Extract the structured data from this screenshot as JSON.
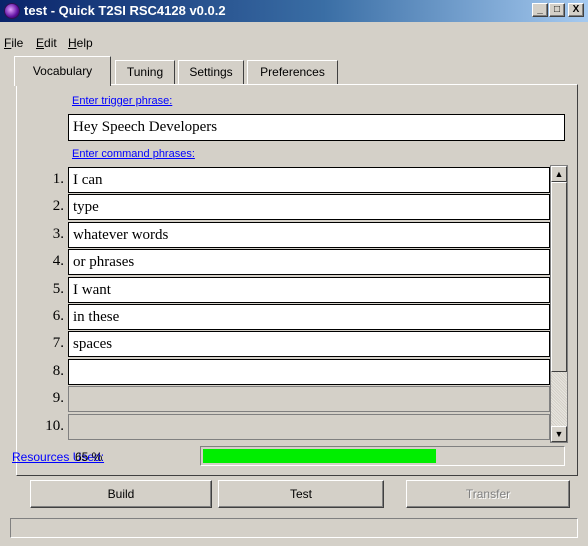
{
  "window": {
    "title": "test - Quick T2SI RSC4128 v0.0.2"
  },
  "titlebar_buttons": {
    "minimize": "_",
    "maximize": "□",
    "close": "X"
  },
  "menu": [
    "File",
    "Edit",
    "Help"
  ],
  "tabs": [
    "Vocabulary",
    "Tuning",
    "Settings",
    "Preferences"
  ],
  "vocabulary": {
    "trigger_label": "Enter trigger phrase:",
    "trigger_value": "Hey Speech Developers",
    "command_label": "Enter command phrases:",
    "commands": [
      {
        "num": "1.",
        "text": "I can"
      },
      {
        "num": "2.",
        "text": "type"
      },
      {
        "num": "3.",
        "text": "whatever words"
      },
      {
        "num": "4.",
        "text": "or phrases"
      },
      {
        "num": "5.",
        "text": "I want"
      },
      {
        "num": "6.",
        "text": "in these"
      },
      {
        "num": "7.",
        "text": "spaces"
      },
      {
        "num": "8.",
        "text": ""
      },
      {
        "num": "9.",
        "text": ""
      },
      {
        "num": "10.",
        "text": ""
      }
    ]
  },
  "resources": {
    "label": "Resources Used:",
    "percent_text": "65 %",
    "percent": 65,
    "bar_color": "#00ee00"
  },
  "buttons": {
    "build": "Build",
    "test": "Test",
    "transfer": "Transfer"
  },
  "status": ""
}
